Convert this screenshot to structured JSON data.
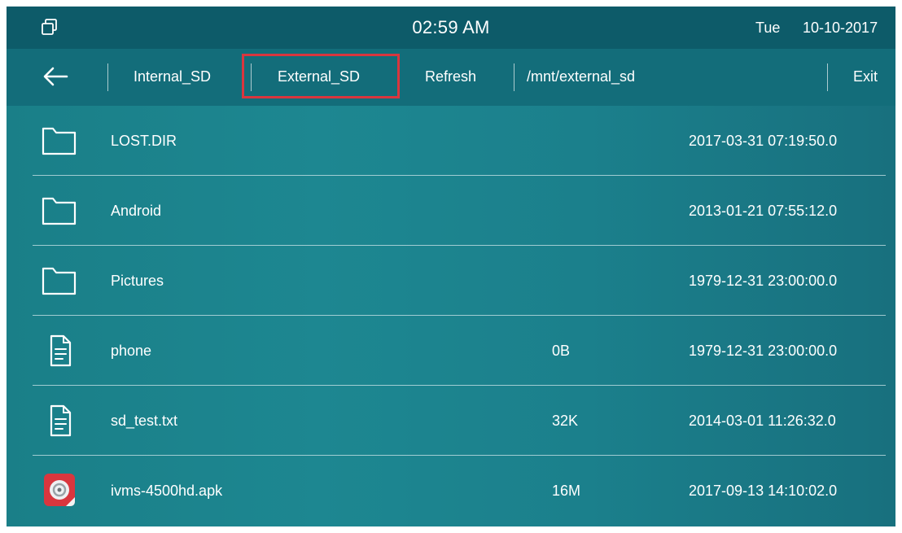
{
  "status_bar": {
    "time": "02:59 AM",
    "day": "Tue",
    "date": "10-10-2017",
    "window_icon": "window-restore-icon"
  },
  "toolbar": {
    "back_icon": "arrow-left-icon",
    "internal_sd": "Internal_SD",
    "external_sd": "External_SD",
    "refresh": "Refresh",
    "path": "/mnt/external_sd",
    "exit": "Exit",
    "selected_tab": "External_SD",
    "highlight_color": "#d9363e"
  },
  "files": [
    {
      "name": "LOST.DIR",
      "size": "",
      "modified": "2017-03-31 07:19:50.0",
      "icon": "folder-icon"
    },
    {
      "name": "Android",
      "size": "",
      "modified": "2013-01-21 07:55:12.0",
      "icon": "folder-icon"
    },
    {
      "name": "Pictures",
      "size": "",
      "modified": "1979-12-31 23:00:00.0",
      "icon": "folder-icon"
    },
    {
      "name": "phone",
      "size": "0B",
      "modified": "1979-12-31 23:00:00.0",
      "icon": "document-icon"
    },
    {
      "name": "sd_test.txt",
      "size": "32K",
      "modified": "2014-03-01 11:26:32.0",
      "icon": "document-icon"
    },
    {
      "name": "ivms-4500hd.apk",
      "size": "16M",
      "modified": "2017-09-13 14:10:02.0",
      "icon": "apk-app-icon"
    }
  ],
  "colors": {
    "status_bar_bg": "#0d5b69",
    "toolbar_bg": "#136d7a",
    "content_bg": "#1d8791",
    "text": "#ffffff"
  }
}
